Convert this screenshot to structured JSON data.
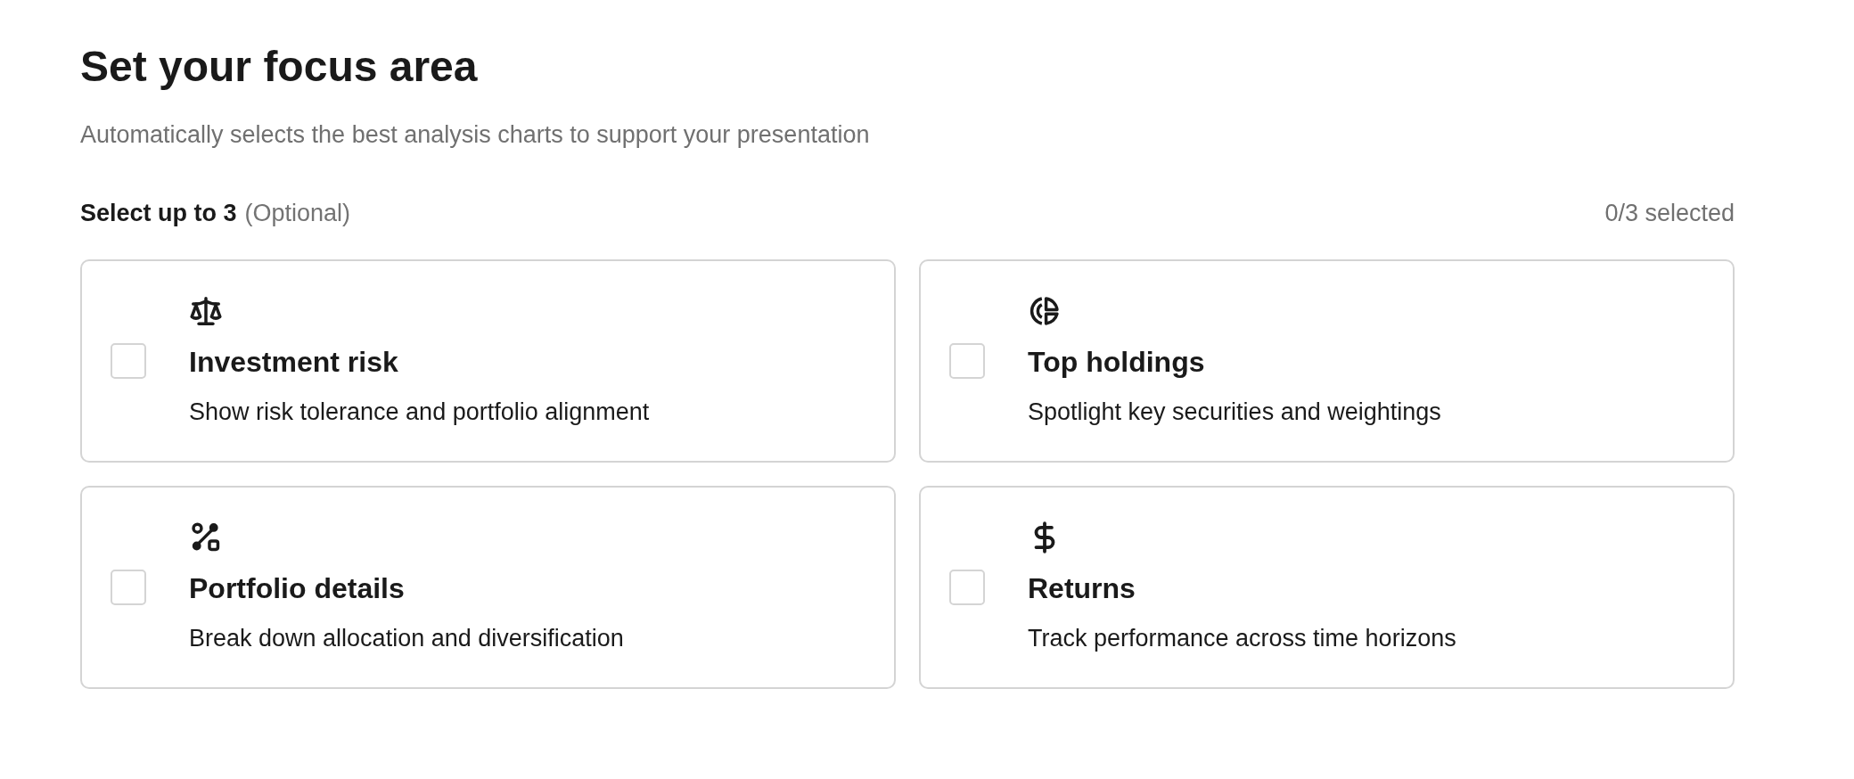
{
  "title": "Set your focus area",
  "subtitle": "Automatically selects the best analysis charts to support your presentation",
  "selection": {
    "label": "Select up to 3",
    "hint": "(Optional)",
    "counter": "0/3 selected"
  },
  "options": [
    {
      "title": "Investment risk",
      "description": "Show risk tolerance and portfolio alignment",
      "checked": false
    },
    {
      "title": "Top holdings",
      "description": "Spotlight key securities and weightings",
      "checked": false
    },
    {
      "title": "Portfolio details",
      "description": "Break down allocation and diversification",
      "checked": false
    },
    {
      "title": "Returns",
      "description": "Track performance across time horizons",
      "checked": false
    }
  ]
}
